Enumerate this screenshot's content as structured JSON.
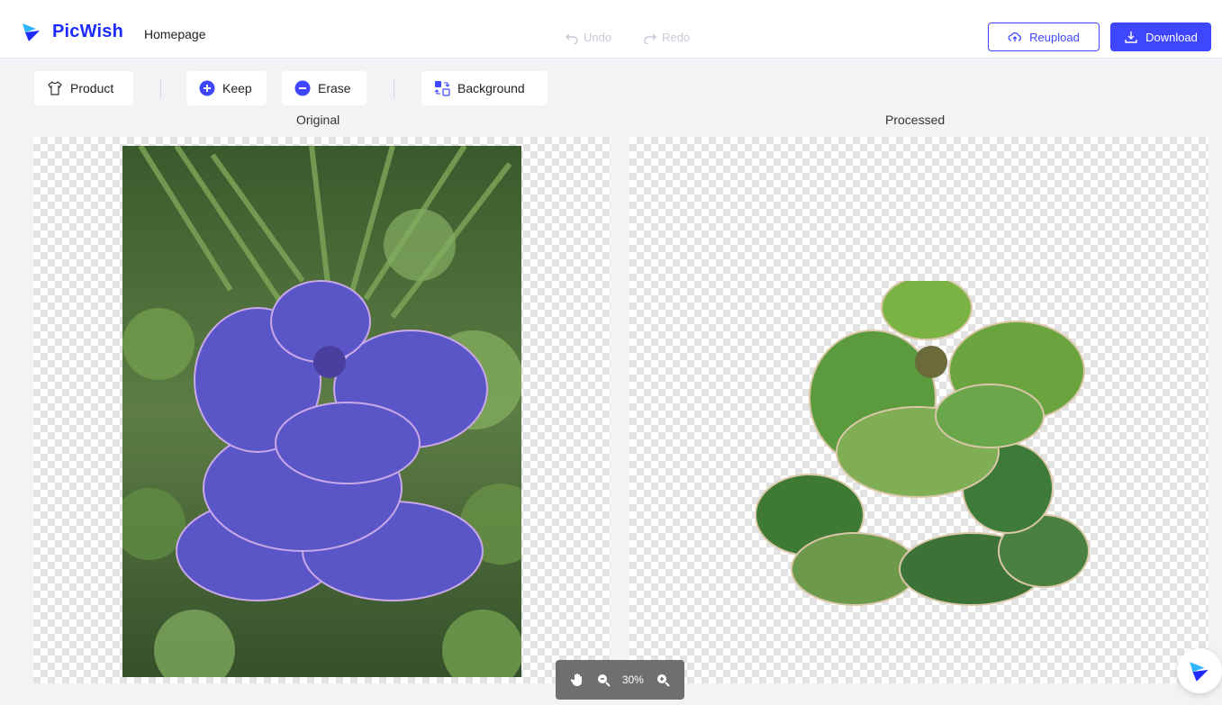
{
  "header": {
    "brand": "PicWish",
    "homepage_link": "Homepage",
    "undo_label": "Undo",
    "redo_label": "Redo",
    "reupload_label": "Reupload",
    "download_label": "Download"
  },
  "toolbar": {
    "product_label": "Product",
    "keep_label": "Keep",
    "erase_label": "Erase",
    "background_label": "Background"
  },
  "panels": {
    "original_caption": "Original",
    "processed_caption": "Processed"
  },
  "zoom": {
    "level": "30%"
  },
  "colors": {
    "brand": "#1e2bff",
    "accent": "#3e46ff"
  }
}
